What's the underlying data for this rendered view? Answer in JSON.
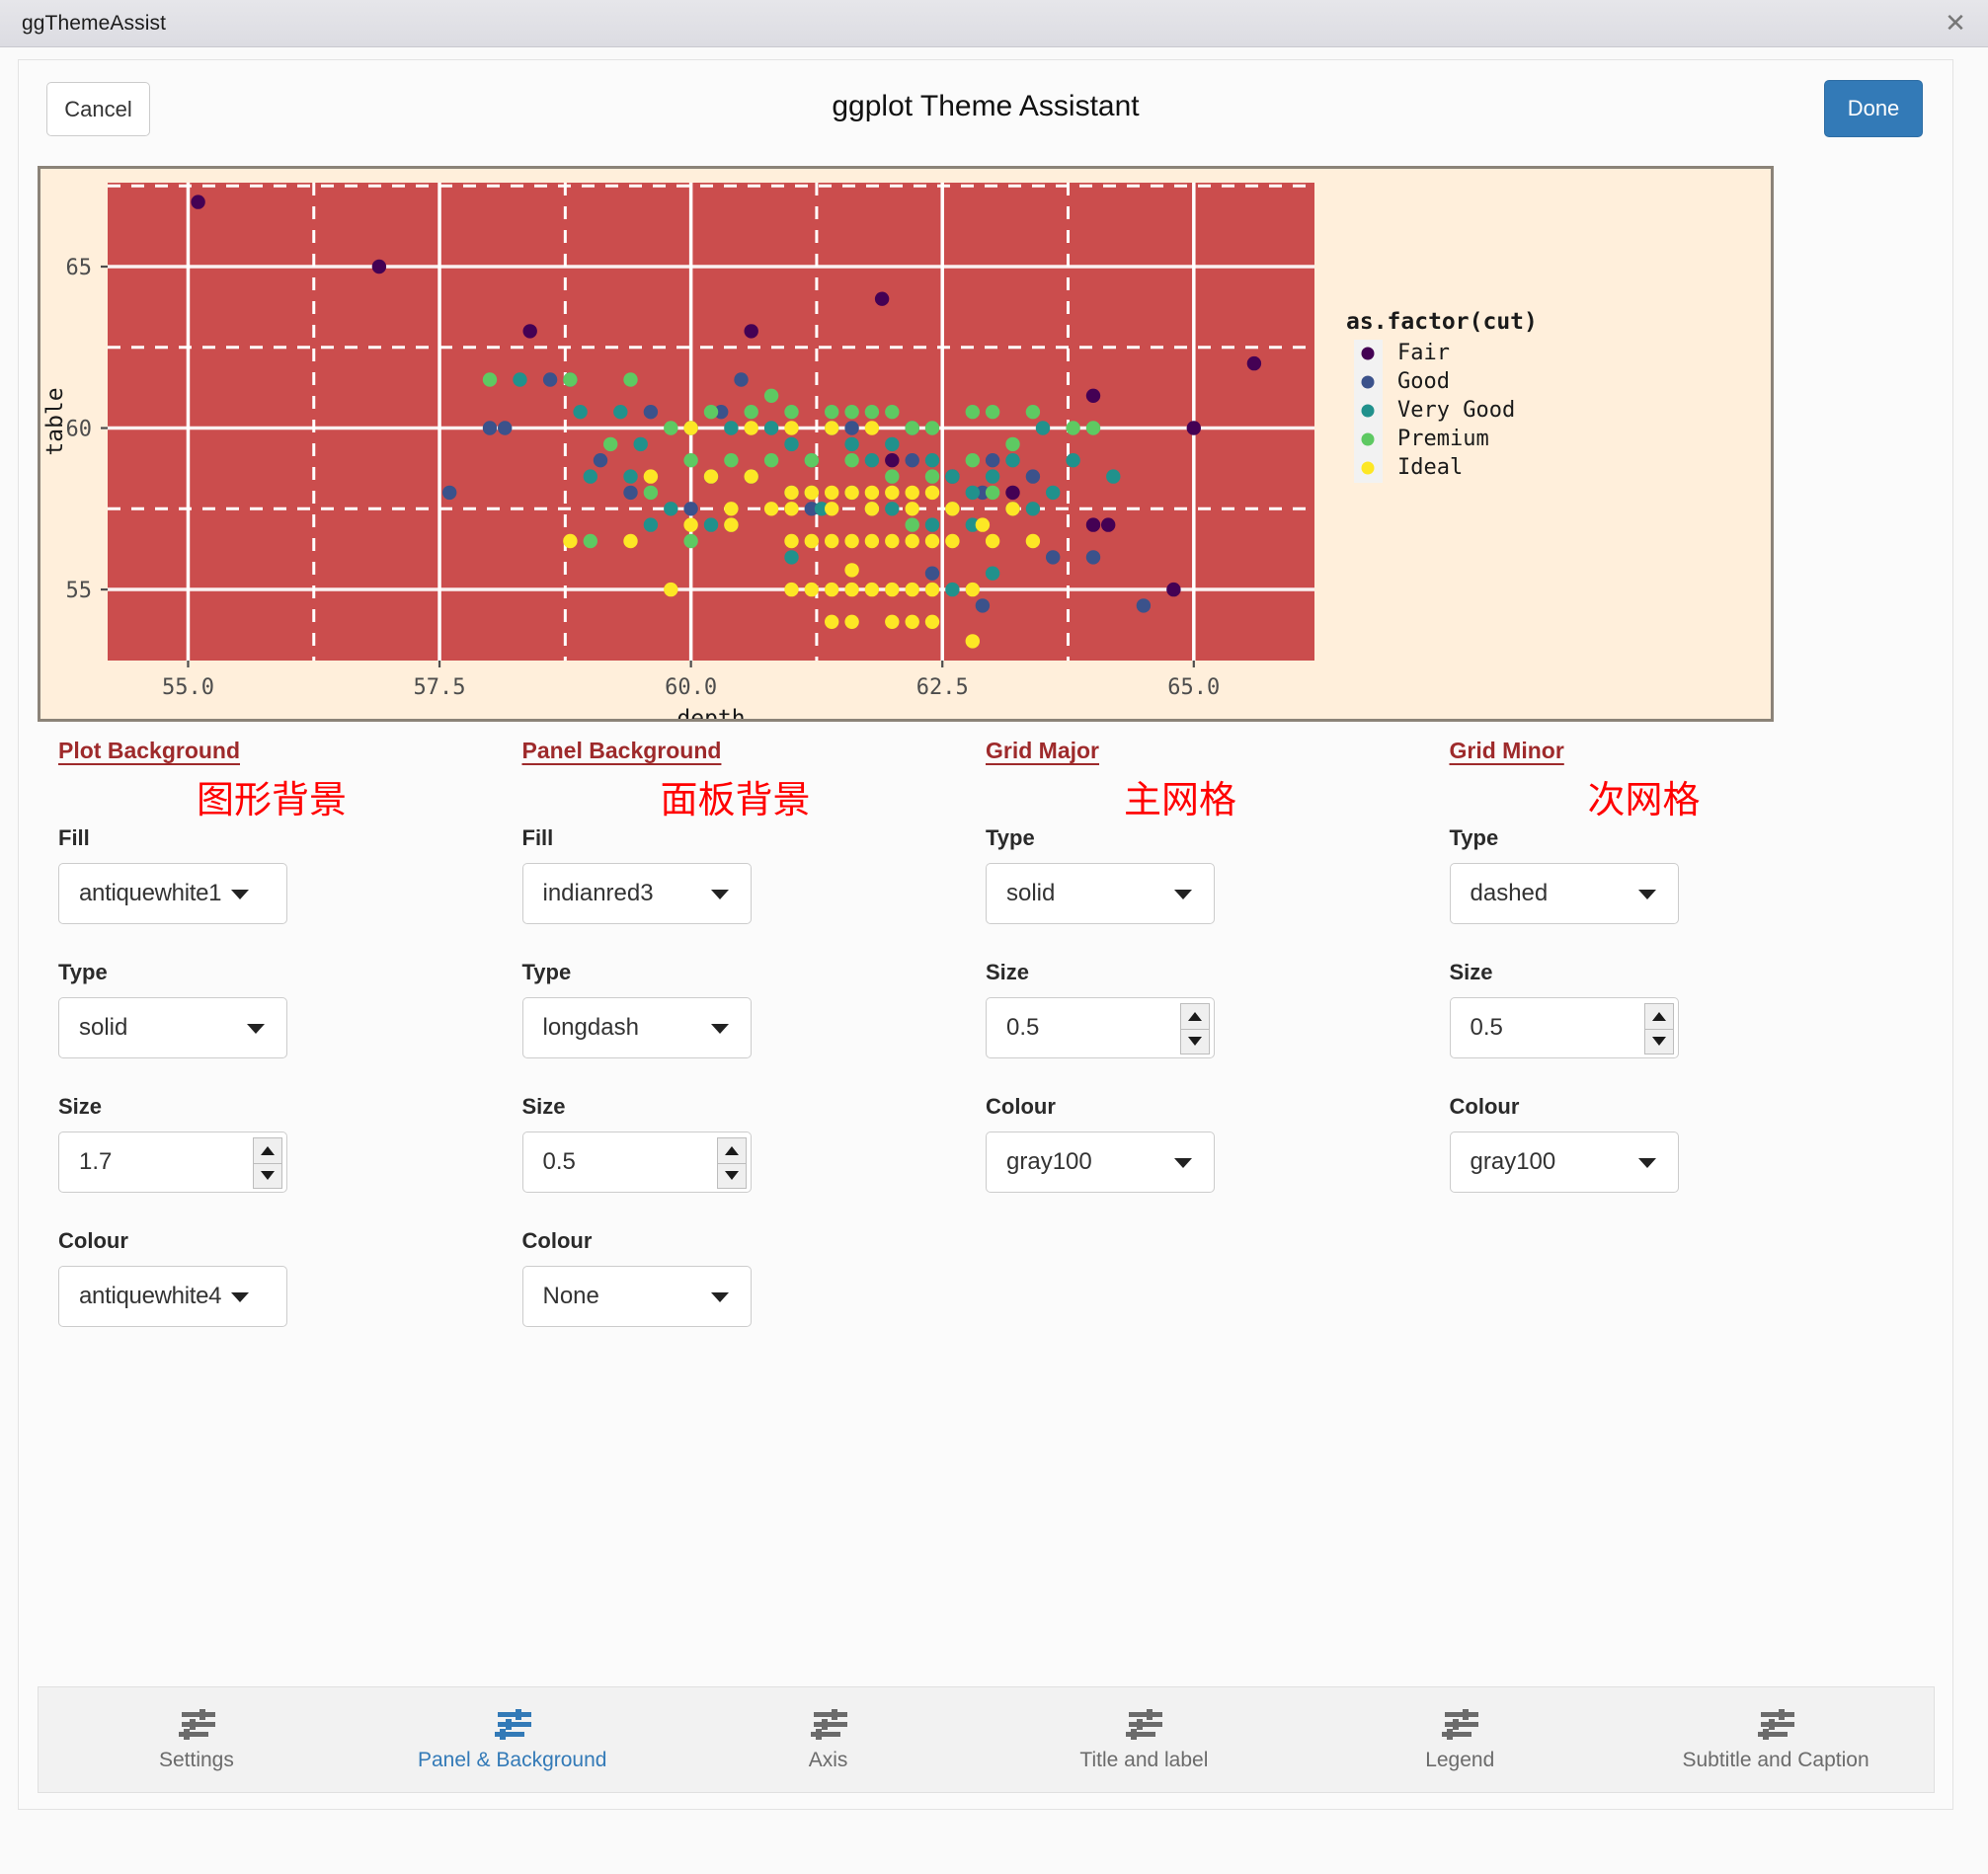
{
  "window": {
    "title": "ggThemeAssist",
    "close_icon": "close-icon"
  },
  "header": {
    "cancel_label": "Cancel",
    "title": "ggplot Theme Assistant",
    "done_label": "Done"
  },
  "chart_data": {
    "type": "scatter",
    "title": "",
    "xlabel": "depth",
    "ylabel": "table",
    "xlim": [
      54.2,
      66.2
    ],
    "ylim": [
      52.8,
      67.6
    ],
    "xticks": [
      "55.0",
      "57.5",
      "60.0",
      "62.5",
      "65.0"
    ],
    "xtick_values": [
      55.0,
      57.5,
      60.0,
      62.5,
      65.0
    ],
    "yticks": [
      "55",
      "60",
      "65"
    ],
    "ytick_values": [
      55,
      60,
      65
    ],
    "grid_major": "solid white",
    "grid_minor": "dashed white",
    "panel_fill": "#cb4d4d",
    "plot_fill": "#ffefdb",
    "plot_border": "#8b8378",
    "legend": {
      "title": "as.factor(cut)",
      "position": "right",
      "entries": [
        {
          "label": "Fair",
          "color": "#440154"
        },
        {
          "label": "Good",
          "color": "#3b528b"
        },
        {
          "label": "Very Good",
          "color": "#21918c"
        },
        {
          "label": "Premium",
          "color": "#5ec962"
        },
        {
          "label": "Ideal",
          "color": "#fde725"
        }
      ]
    },
    "series": [
      {
        "name": "Fair",
        "color": "#440154",
        "points": [
          [
            55.1,
            67.0
          ],
          [
            56.9,
            65.0
          ],
          [
            58.4,
            63.0
          ],
          [
            60.6,
            63.0
          ],
          [
            61.9,
            64.0
          ],
          [
            64.0,
            61.0
          ],
          [
            65.6,
            62.0
          ],
          [
            65.0,
            60.0
          ],
          [
            64.0,
            57.0
          ],
          [
            64.15,
            57.0
          ],
          [
            64.8,
            55.0
          ],
          [
            63.2,
            58.0
          ],
          [
            62.0,
            59.0
          ]
        ]
      },
      {
        "name": "Good",
        "color": "#3b528b",
        "points": [
          [
            58.6,
            61.5
          ],
          [
            58.0,
            60.0
          ],
          [
            58.15,
            60.0
          ],
          [
            57.6,
            58.0
          ],
          [
            59.1,
            59.0
          ],
          [
            59.6,
            60.5
          ],
          [
            60.5,
            61.5
          ],
          [
            60.3,
            60.5
          ],
          [
            61.6,
            60.0
          ],
          [
            62.2,
            59.0
          ],
          [
            62.6,
            58.5
          ],
          [
            62.9,
            58.0
          ],
          [
            63.2,
            57.5
          ],
          [
            63.0,
            59.0
          ],
          [
            63.6,
            56.0
          ],
          [
            62.4,
            55.5
          ],
          [
            62.9,
            54.5
          ],
          [
            64.5,
            54.5
          ],
          [
            64.0,
            56.0
          ],
          [
            61.2,
            57.5
          ],
          [
            63.4,
            58.5
          ],
          [
            60.0,
            57.5
          ],
          [
            59.4,
            58.0
          ],
          [
            58.8,
            61.5
          ]
        ]
      },
      {
        "name": "Very Good",
        "color": "#21918c",
        "points": [
          [
            58.3,
            61.5
          ],
          [
            58.9,
            60.5
          ],
          [
            59.3,
            60.5
          ],
          [
            59.5,
            59.5
          ],
          [
            60.0,
            60.0
          ],
          [
            60.4,
            60.0
          ],
          [
            60.8,
            60.0
          ],
          [
            61.0,
            59.5
          ],
          [
            61.2,
            59.0
          ],
          [
            61.4,
            60.0
          ],
          [
            61.6,
            59.5
          ],
          [
            61.8,
            59.0
          ],
          [
            62.0,
            59.5
          ],
          [
            62.2,
            60.0
          ],
          [
            62.4,
            59.0
          ],
          [
            62.6,
            58.5
          ],
          [
            62.8,
            58.0
          ],
          [
            63.0,
            58.5
          ],
          [
            63.2,
            59.0
          ],
          [
            60.2,
            58.5
          ],
          [
            60.6,
            58.5
          ],
          [
            61.0,
            58.0
          ],
          [
            61.3,
            57.5
          ],
          [
            61.6,
            58.0
          ],
          [
            62.0,
            57.5
          ],
          [
            62.4,
            57.0
          ],
          [
            62.8,
            57.0
          ],
          [
            63.4,
            57.5
          ],
          [
            59.8,
            57.5
          ],
          [
            59.4,
            58.5
          ],
          [
            63.8,
            59.0
          ],
          [
            63.5,
            60.0
          ],
          [
            63.0,
            55.5
          ],
          [
            62.6,
            55.0
          ],
          [
            61.0,
            56.0
          ],
          [
            60.2,
            57.0
          ],
          [
            59.6,
            57.0
          ],
          [
            63.6,
            58.0
          ],
          [
            64.2,
            58.5
          ],
          [
            59.0,
            58.5
          ]
        ]
      },
      {
        "name": "Premium",
        "color": "#5ec962",
        "points": [
          [
            58.0,
            61.5
          ],
          [
            58.8,
            61.5
          ],
          [
            59.4,
            61.5
          ],
          [
            59.8,
            60.0
          ],
          [
            60.2,
            60.5
          ],
          [
            60.6,
            60.5
          ],
          [
            60.8,
            61.0
          ],
          [
            61.0,
            60.5
          ],
          [
            61.4,
            60.5
          ],
          [
            61.6,
            60.5
          ],
          [
            61.8,
            60.5
          ],
          [
            62.0,
            60.5
          ],
          [
            62.2,
            60.0
          ],
          [
            62.4,
            60.0
          ],
          [
            62.8,
            60.5
          ],
          [
            63.0,
            60.5
          ],
          [
            63.4,
            60.5
          ],
          [
            60.0,
            59.0
          ],
          [
            60.4,
            59.0
          ],
          [
            60.8,
            59.0
          ],
          [
            61.2,
            59.0
          ],
          [
            61.6,
            59.0
          ],
          [
            62.0,
            58.5
          ],
          [
            62.4,
            58.5
          ],
          [
            62.8,
            59.0
          ],
          [
            63.2,
            59.5
          ],
          [
            59.2,
            59.5
          ],
          [
            59.6,
            58.0
          ],
          [
            59.0,
            56.5
          ],
          [
            60.0,
            56.5
          ],
          [
            61.8,
            57.5
          ],
          [
            62.6,
            57.5
          ],
          [
            63.0,
            58.0
          ],
          [
            60.4,
            57.0
          ],
          [
            61.2,
            58.0
          ],
          [
            62.2,
            57.0
          ],
          [
            63.8,
            60.0
          ],
          [
            64.0,
            60.0
          ]
        ]
      },
      {
        "name": "Ideal",
        "color": "#fde725",
        "points": [
          [
            60.0,
            60.0
          ],
          [
            60.6,
            60.0
          ],
          [
            61.0,
            60.0
          ],
          [
            61.4,
            60.0
          ],
          [
            61.8,
            60.0
          ],
          [
            59.6,
            58.5
          ],
          [
            60.2,
            58.5
          ],
          [
            60.6,
            58.5
          ],
          [
            61.0,
            58.0
          ],
          [
            61.2,
            58.0
          ],
          [
            61.4,
            58.0
          ],
          [
            61.6,
            58.0
          ],
          [
            61.8,
            58.0
          ],
          [
            62.0,
            58.0
          ],
          [
            62.2,
            58.0
          ],
          [
            62.4,
            58.0
          ],
          [
            60.4,
            57.5
          ],
          [
            60.8,
            57.5
          ],
          [
            61.0,
            57.5
          ],
          [
            61.4,
            57.5
          ],
          [
            61.8,
            57.5
          ],
          [
            62.2,
            57.5
          ],
          [
            62.6,
            57.5
          ],
          [
            60.0,
            57.0
          ],
          [
            60.4,
            57.0
          ],
          [
            61.0,
            56.5
          ],
          [
            61.2,
            56.5
          ],
          [
            61.4,
            56.5
          ],
          [
            61.6,
            56.5
          ],
          [
            61.8,
            56.5
          ],
          [
            62.0,
            56.5
          ],
          [
            62.2,
            56.5
          ],
          [
            62.4,
            56.5
          ],
          [
            62.6,
            56.5
          ],
          [
            63.0,
            56.5
          ],
          [
            63.4,
            56.5
          ],
          [
            59.8,
            55.0
          ],
          [
            61.0,
            55.0
          ],
          [
            61.2,
            55.0
          ],
          [
            61.4,
            55.0
          ],
          [
            61.6,
            55.0
          ],
          [
            61.8,
            55.0
          ],
          [
            62.0,
            55.0
          ],
          [
            62.2,
            55.0
          ],
          [
            62.4,
            55.0
          ],
          [
            62.8,
            55.0
          ],
          [
            61.6,
            55.6
          ],
          [
            61.4,
            54.0
          ],
          [
            61.6,
            54.0
          ],
          [
            62.0,
            54.0
          ],
          [
            62.2,
            54.0
          ],
          [
            62.4,
            54.0
          ],
          [
            62.8,
            53.4
          ],
          [
            58.8,
            56.5
          ],
          [
            59.4,
            56.5
          ],
          [
            62.9,
            57.0
          ],
          [
            63.2,
            57.5
          ]
        ]
      }
    ]
  },
  "controls": {
    "sections": [
      {
        "heading": "Plot Background",
        "note": "图形背景",
        "fields": [
          {
            "label": "Fill",
            "type": "select",
            "value": "antiquewhite1"
          },
          {
            "label": "Type",
            "type": "select",
            "value": "solid"
          },
          {
            "label": "Size",
            "type": "number",
            "value": "1.7"
          },
          {
            "label": "Colour",
            "type": "select",
            "value": "antiquewhite4"
          }
        ]
      },
      {
        "heading": "Panel Background",
        "note": "面板背景",
        "fields": [
          {
            "label": "Fill",
            "type": "select",
            "value": "indianred3"
          },
          {
            "label": "Type",
            "type": "select",
            "value": "longdash"
          },
          {
            "label": "Size",
            "type": "number",
            "value": "0.5"
          },
          {
            "label": "Colour",
            "type": "select",
            "value": "None"
          }
        ]
      },
      {
        "heading": "Grid Major",
        "note": "主网格",
        "fields": [
          {
            "label": "Type",
            "type": "select",
            "value": "solid"
          },
          {
            "label": "Size",
            "type": "number",
            "value": "0.5"
          },
          {
            "label": "Colour",
            "type": "select",
            "value": "gray100"
          }
        ]
      },
      {
        "heading": "Grid Minor",
        "note": "次网格",
        "fields": [
          {
            "label": "Type",
            "type": "select",
            "value": "dashed"
          },
          {
            "label": "Size",
            "type": "number",
            "value": "0.5"
          },
          {
            "label": "Colour",
            "type": "select",
            "value": "gray100"
          }
        ]
      }
    ]
  },
  "tabs": [
    {
      "label": "Settings",
      "icon": "sliders-icon",
      "active": false
    },
    {
      "label": "Panel & Background",
      "icon": "sliders-icon",
      "active": true
    },
    {
      "label": "Axis",
      "icon": "sliders-icon",
      "active": false
    },
    {
      "label": "Title and label",
      "icon": "sliders-icon",
      "active": false
    },
    {
      "label": "Legend",
      "icon": "sliders-icon",
      "active": false
    },
    {
      "label": "Subtitle and Caption",
      "icon": "sliders-icon",
      "active": false
    }
  ],
  "colors": {
    "accent": "#337ab7",
    "heading": "#9e2a2b",
    "note": "#ff0000",
    "panel": "#cb4d4d",
    "plot_bg": "#ffefdb"
  }
}
